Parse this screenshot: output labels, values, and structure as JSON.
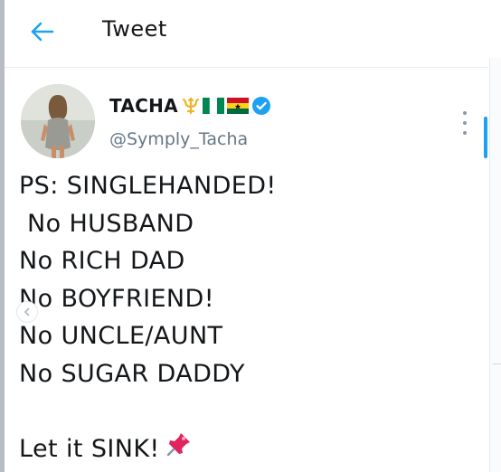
{
  "header": {
    "title": "Tweet",
    "back_icon": "arrow-left-icon"
  },
  "tweet": {
    "author_name": "TACHA",
    "author_emojis": [
      "trident-emoji",
      "nigeria-flag-emoji",
      "ghana-flag-emoji"
    ],
    "verified": true,
    "handle": "@Symply_Tacha",
    "lines": [
      "PS: SINGLEHANDED!",
      " No HUSBAND",
      "No RICH DAD",
      "No BOYFRIEND!",
      "No UNCLE/AUNT",
      "No SUGAR DADDY",
      "",
      "Let it SINK!"
    ],
    "trailing_emoji": "pushpin-icon"
  },
  "colors": {
    "accent": "#1da1f2",
    "text": "#14171a",
    "secondary": "#657786"
  }
}
